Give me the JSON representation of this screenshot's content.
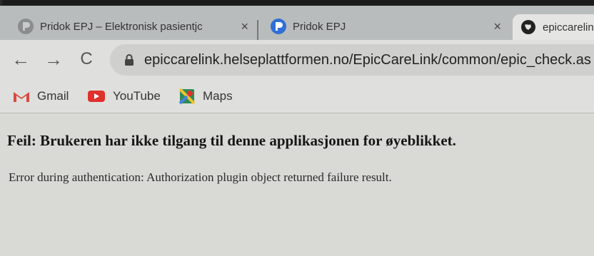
{
  "tabs": [
    {
      "title": "Pridok EPJ – Elektronisk pasientjc",
      "close_icon": "×",
      "favicon": "pridok-icon"
    },
    {
      "title": "Pridok EPJ",
      "close_icon": "×",
      "favicon": "pridok-icon"
    },
    {
      "title": "epiccarelink",
      "favicon": "globe-icon"
    }
  ],
  "toolbar": {
    "back_icon": "←",
    "forward_icon": "→",
    "reload_icon": "C",
    "url": "epiccarelink.helseplattformen.no/EpicCareLink/common/epic_check.as"
  },
  "bookmarks": [
    {
      "label": "Gmail",
      "icon": "gmail-icon"
    },
    {
      "label": "YouTube",
      "icon": "youtube-icon"
    },
    {
      "label": "Maps",
      "icon": "maps-icon"
    }
  ],
  "page": {
    "error_title": "Feil: Brukeren har ikke tilgang til denne applikasjonen for øyeblikket.",
    "error_message": "Error during authentication: Authorization plugin object returned failure result."
  },
  "colors": {
    "pridok_blue": "#2f6fd6",
    "youtube_red": "#e0312c",
    "gmail_red": "#d84a3d"
  }
}
